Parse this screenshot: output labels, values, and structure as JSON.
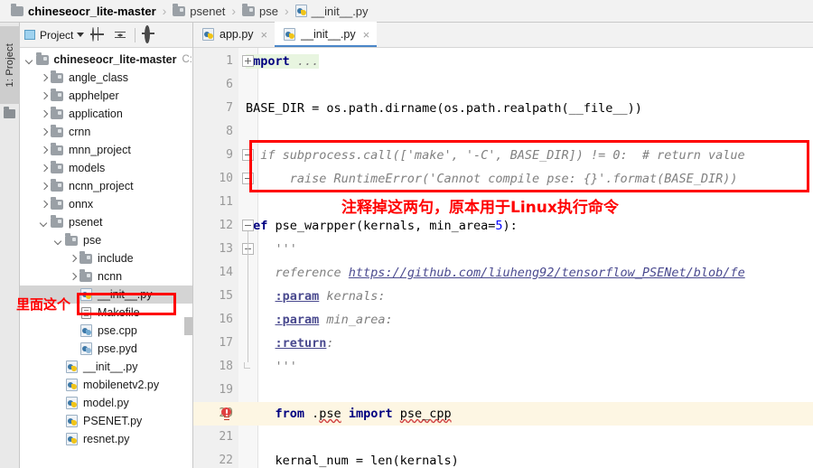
{
  "breadcrumb": {
    "items": [
      {
        "label": "chineseocr_lite-master",
        "icon": "folder-icon"
      },
      {
        "label": "psenet",
        "icon": "folder-icon"
      },
      {
        "label": "pse",
        "icon": "folder-icon"
      },
      {
        "label": "__init__.py",
        "icon": "python-file-icon"
      }
    ],
    "separator": "›"
  },
  "tool_window_tab": {
    "label": "1: Project"
  },
  "project_panel": {
    "title": "Project",
    "toolbar": {
      "locate_icon": "target-icon",
      "collapse_icon": "collapse-all-icon",
      "settings_icon": "gear-icon",
      "hide_icon": "minimize-icon"
    },
    "tree": [
      {
        "label": "chineseocr_lite-master",
        "path_hint": "C:",
        "type": "folder",
        "state": "open",
        "depth": 0,
        "bold": true
      },
      {
        "label": "angle_class",
        "type": "folder",
        "state": "closed",
        "depth": 1
      },
      {
        "label": "apphelper",
        "type": "folder",
        "state": "closed",
        "depth": 1
      },
      {
        "label": "application",
        "type": "folder",
        "state": "closed",
        "depth": 1
      },
      {
        "label": "crnn",
        "type": "folder",
        "state": "closed",
        "depth": 1
      },
      {
        "label": "mnn_project",
        "type": "folder",
        "state": "closed",
        "depth": 1
      },
      {
        "label": "models",
        "type": "folder",
        "state": "closed",
        "depth": 1
      },
      {
        "label": "ncnn_project",
        "type": "folder",
        "state": "closed",
        "depth": 1
      },
      {
        "label": "onnx",
        "type": "folder",
        "state": "closed",
        "depth": 1
      },
      {
        "label": "psenet",
        "type": "folder",
        "state": "open",
        "depth": 1
      },
      {
        "label": "pse",
        "type": "folder",
        "state": "open",
        "depth": 2
      },
      {
        "label": "include",
        "type": "folder",
        "state": "closed",
        "depth": 3
      },
      {
        "label": "ncnn",
        "type": "folder",
        "state": "closed",
        "depth": 3
      },
      {
        "label": "__init__.py",
        "type": "python",
        "depth": 3,
        "selected": true
      },
      {
        "label": "Makefile",
        "type": "makefile",
        "depth": 3
      },
      {
        "label": "pse.cpp",
        "type": "cpp",
        "depth": 3
      },
      {
        "label": "pse.pyd",
        "type": "pyd",
        "depth": 3
      },
      {
        "label": "__init__.py",
        "type": "python",
        "depth": 2
      },
      {
        "label": "mobilenetv2.py",
        "type": "python",
        "depth": 2
      },
      {
        "label": "model.py",
        "type": "python",
        "depth": 2
      },
      {
        "label": "PSENET.py",
        "type": "python",
        "depth": 2
      },
      {
        "label": "resnet.py",
        "type": "python",
        "depth": 2
      }
    ]
  },
  "editor": {
    "tabs": [
      {
        "label": "app.py",
        "icon": "python-file-icon",
        "active": false,
        "close": "×"
      },
      {
        "label": "__init__.py",
        "icon": "python-file-icon",
        "active": true,
        "close": "×"
      }
    ],
    "lines": [
      {
        "num": "1",
        "text": "import ...",
        "kind": "folded-import",
        "fold": "plus"
      },
      {
        "num": "6",
        "text": "",
        "kind": "blank"
      },
      {
        "num": "7",
        "text": "BASE_DIR = os.path.dirname(os.path.realpath(__file__))",
        "kind": "code"
      },
      {
        "num": "8",
        "text": "",
        "kind": "blank"
      },
      {
        "num": "9",
        "text": "# if subprocess.call(['make', '-C', BASE_DIR]) != 0:  # return value",
        "kind": "comment",
        "fold": "minus"
      },
      {
        "num": "10",
        "text": "#     raise RuntimeError('Cannot compile pse: {}'.format(BASE_DIR))",
        "kind": "comment",
        "fold": "minus"
      },
      {
        "num": "11",
        "text": "",
        "kind": "blank"
      },
      {
        "num": "12",
        "text": "def pse_warpper(kernals, min_area=5):",
        "kind": "def",
        "fold": "minus"
      },
      {
        "num": "13",
        "text": "    '''",
        "kind": "doc",
        "fold": "minus"
      },
      {
        "num": "14",
        "text": "    reference https://github.com/liuheng92/tensorflow_PSENet/blob/fe",
        "kind": "doc-link"
      },
      {
        "num": "15",
        "text": "    :param kernals:",
        "kind": "doc-param"
      },
      {
        "num": "16",
        "text": "    :param min_area:",
        "kind": "doc-param"
      },
      {
        "num": "17",
        "text": "    :return:",
        "kind": "doc-param"
      },
      {
        "num": "18",
        "text": "    '''",
        "kind": "doc",
        "fold": "end"
      },
      {
        "num": "19",
        "text": "",
        "kind": "blank"
      },
      {
        "num": "20",
        "text": "    from .pse import pse_cpp",
        "kind": "import-line",
        "current": true,
        "gutter_icon": "error-bulb-icon"
      },
      {
        "num": "21",
        "text": "",
        "kind": "blank"
      },
      {
        "num": "22",
        "text": "    kernal_num = len(kernals)",
        "kind": "code"
      }
    ]
  },
  "annotations": {
    "tree_note": "里面这个",
    "code_note": "注释掉这两句，原本用于Linux执行命令",
    "color": "#ff0000"
  }
}
